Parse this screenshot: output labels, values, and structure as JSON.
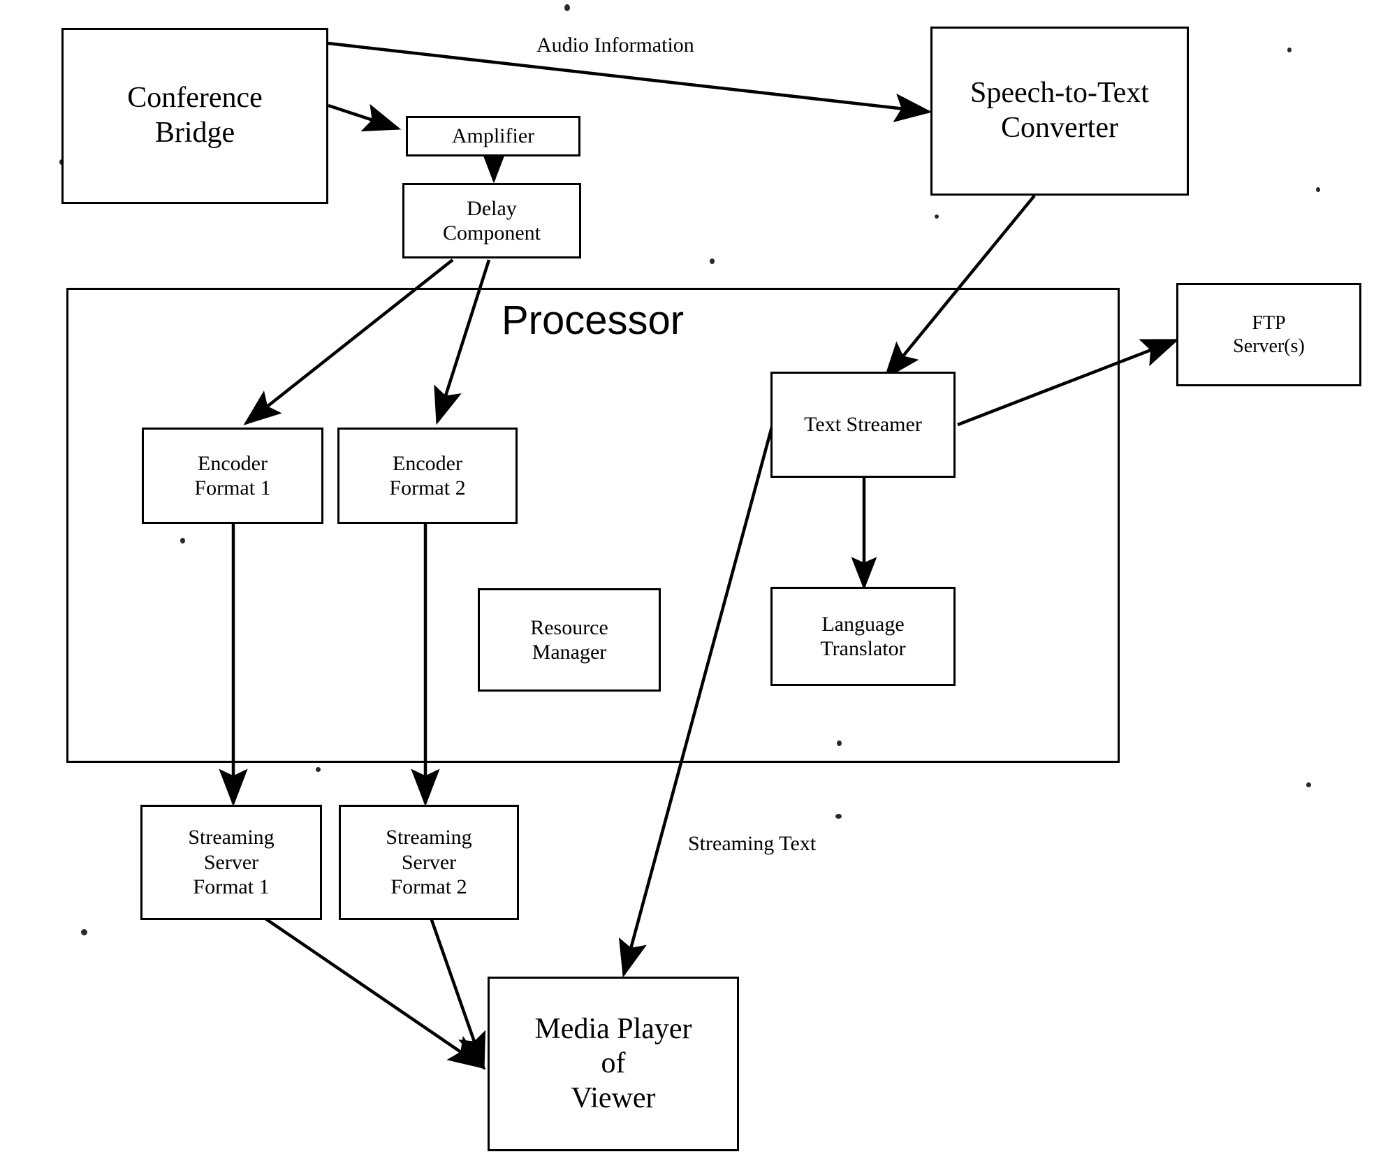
{
  "diagram": {
    "title_visible": false,
    "background_color": "#ffffff",
    "line_color": "#000000",
    "nodes": {
      "conference_bridge": {
        "label": "Conference\nBridge",
        "line1": "Conference",
        "line2": "Bridge"
      },
      "amplifier": {
        "label": "Amplifier"
      },
      "delay_component": {
        "line1": "Delay",
        "line2": "Component"
      },
      "speech_to_text": {
        "line1": "Speech-to-Text",
        "line2": "Converter"
      },
      "ftp_servers": {
        "line1": "FTP",
        "line2": "Server(s)"
      },
      "processor": {
        "label": "Processor"
      },
      "encoder_format_1": {
        "line1": "Encoder",
        "line2": "Format 1"
      },
      "encoder_format_2": {
        "line1": "Encoder",
        "line2": "Format 2"
      },
      "resource_manager": {
        "line1": "Resource",
        "line2": "Manager"
      },
      "text_streamer": {
        "label": "Text Streamer"
      },
      "language_translator": {
        "line1": "Language",
        "line2": "Translator"
      },
      "streaming_server_1": {
        "line1": "Streaming",
        "line2": "Server",
        "line3": "Format 1"
      },
      "streaming_server_2": {
        "line1": "Streaming",
        "line2": "Server",
        "line3": "Format 2"
      },
      "media_player": {
        "line1": "Media Player",
        "line2": "of",
        "line3": "Viewer"
      }
    },
    "edge_labels": {
      "audio_information": "Audio Information",
      "streaming_text": "Streaming Text"
    },
    "connections": [
      {
        "from": "conference_bridge",
        "to": "speech_to_text",
        "label": "Audio Information",
        "arrow": "single"
      },
      {
        "from": "conference_bridge",
        "to": "amplifier",
        "label": "",
        "arrow": "single"
      },
      {
        "from": "amplifier",
        "to": "delay_component",
        "label": "",
        "arrow": "single"
      },
      {
        "from": "delay_component",
        "to": "encoder_format_1",
        "label": "",
        "arrow": "single"
      },
      {
        "from": "delay_component",
        "to": "encoder_format_2",
        "label": "",
        "arrow": "single"
      },
      {
        "from": "speech_to_text",
        "to": "text_streamer",
        "label": "",
        "arrow": "single"
      },
      {
        "from": "text_streamer",
        "to": "ftp_servers",
        "label": "",
        "arrow": "single"
      },
      {
        "from": "text_streamer",
        "to": "language_translator",
        "label": "",
        "arrow": "double"
      },
      {
        "from": "text_streamer",
        "to": "media_player",
        "label": "Streaming Text",
        "arrow": "single"
      },
      {
        "from": "encoder_format_1",
        "to": "streaming_server_1",
        "label": "",
        "arrow": "single"
      },
      {
        "from": "encoder_format_2",
        "to": "streaming_server_2",
        "label": "",
        "arrow": "single"
      },
      {
        "from": "streaming_server_1",
        "to": "media_player",
        "label": "",
        "arrow": "single"
      },
      {
        "from": "streaming_server_2",
        "to": "media_player",
        "label": "",
        "arrow": "single"
      }
    ]
  }
}
